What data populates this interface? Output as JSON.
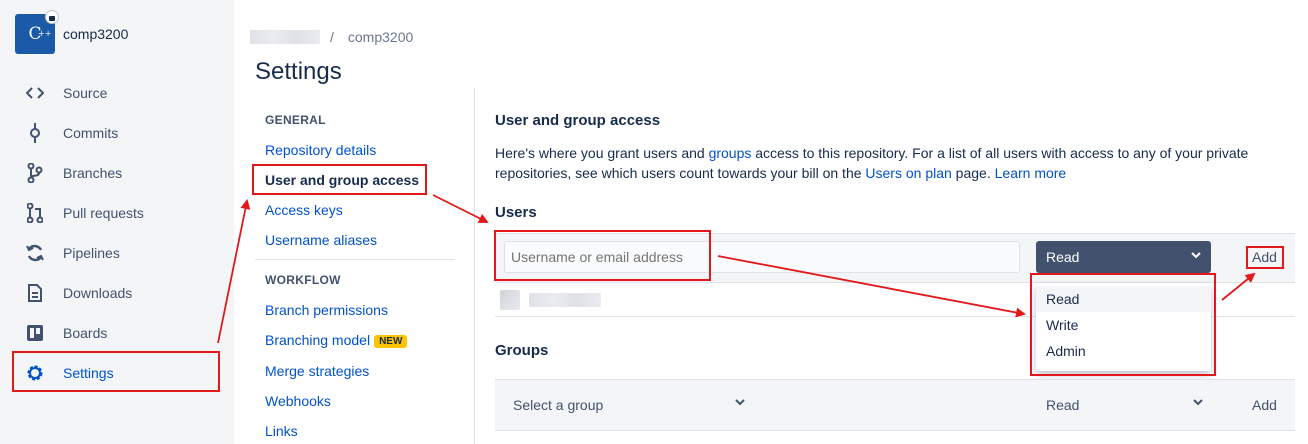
{
  "repo": {
    "name": "comp3200",
    "avatar_text": "C",
    "avatar_sup": "++"
  },
  "leftnav": {
    "items": [
      {
        "label": "Source",
        "icon": "code-icon"
      },
      {
        "label": "Commits",
        "icon": "commit-icon"
      },
      {
        "label": "Branches",
        "icon": "branch-icon"
      },
      {
        "label": "Pull requests",
        "icon": "pull-request-icon"
      },
      {
        "label": "Pipelines",
        "icon": "pipelines-icon"
      },
      {
        "label": "Downloads",
        "icon": "download-file-icon"
      },
      {
        "label": "Boards",
        "icon": "board-icon"
      },
      {
        "label": "Settings",
        "icon": "gear-icon",
        "active": true
      }
    ]
  },
  "breadcrumb": {
    "separator": "/",
    "repo": "comp3200"
  },
  "page": {
    "title": "Settings"
  },
  "subnav": {
    "general_heading": "GENERAL",
    "general": [
      "Repository details",
      "User and group access",
      "Access keys",
      "Username aliases"
    ],
    "workflow_heading": "WORKFLOW",
    "workflow": [
      "Branch permissions",
      "Branching model",
      "Merge strategies",
      "Webhooks",
      "Links"
    ],
    "new_badge": "NEW"
  },
  "main": {
    "title": "User and group access",
    "desc_1": "Here's where you grant users and ",
    "desc_link_groups": "groups",
    "desc_2": " access to this repository. For a list of all users with access to any of your private repositories, see which users count towards your bill on the ",
    "desc_link_users_on_plan": "Users on plan",
    "desc_3": " page. ",
    "desc_link_learn": "Learn more",
    "users_heading": "Users",
    "user_input_placeholder": "Username or email address",
    "permission_selected": "Read",
    "add_label": "Add",
    "permission_options": [
      "Read",
      "Write",
      "Admin"
    ],
    "groups_heading": "Groups",
    "group_select_placeholder": "Select a group",
    "group_permission": "Read",
    "group_add_label": "Add"
  },
  "colors": {
    "accent": "#0052cc",
    "annotation": "#e3181b",
    "select_bg": "#42526e",
    "badge": "#ffc400"
  }
}
